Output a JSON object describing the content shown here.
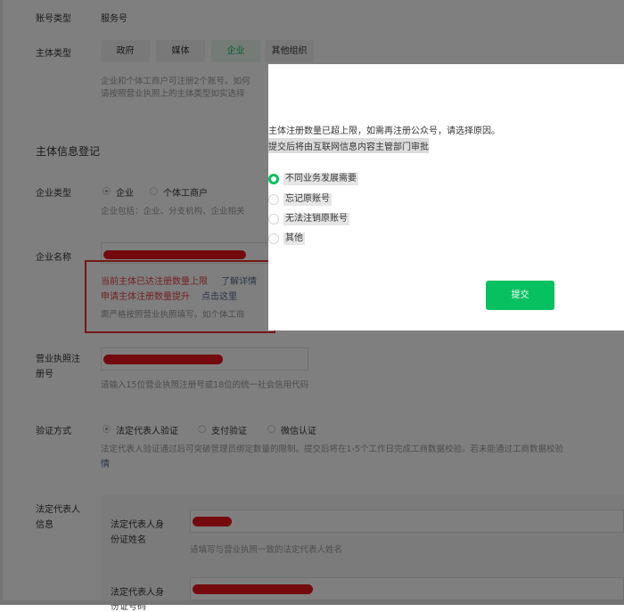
{
  "account_type": {
    "label": "账号类型",
    "value": "服务号"
  },
  "subject_type": {
    "label": "主体类型",
    "options": [
      "政府",
      "媒体",
      "企业",
      "其他组织"
    ],
    "selected": "企业",
    "hint_line1": "企业和个体工商户可注册2个账号。如何",
    "hint_line2": "请按照营业执照上的主体类型如实选择"
  },
  "section_title": "主体信息登记",
  "enterprise_type": {
    "label": "企业类型",
    "options": [
      "企业",
      "个体工商户"
    ],
    "selected": "企业",
    "hint": "企业包括：企业、分支机构、企业相关"
  },
  "enterprise_name": {
    "label": "企业名称",
    "error_line1": "当前主体已达注册数量上限",
    "error_link1": "了解详情",
    "error_line2": "申请主体注册数量提升",
    "error_link2": "点击这里",
    "hint": "需严格按照营业执照填写。如个体工商"
  },
  "license_number": {
    "label_line1": "营业执照注",
    "label_line2": "册号",
    "hint": "请输入15位营业执照注册号或18位的统一社会信用代码"
  },
  "verify_method": {
    "label": "验证方式",
    "options": [
      "法定代表人验证",
      "支付验证",
      "微信认证"
    ],
    "selected": "法定代表人验证",
    "hint_line1": "法定代表人验证通过后可突破管理员绑定数量的限制。提交后将在1-5个工作日完成工商数据校验。若未能通过工商数据校验",
    "hint_line2": "情"
  },
  "legal_rep": {
    "label_line1": "法定代表人",
    "label_line2": "信息",
    "name_label_line1": "法定代表人身",
    "name_label_line2": "份证姓名",
    "name_hint": "请填写与营业执照一致的法定代表人姓名",
    "id_label_line1": "法定代表人身",
    "id_label_line2": "份证号码"
  },
  "dialog": {
    "message_line1": "主体注册数量已超上限，如需再注册公众号，请选择原因。",
    "message_line2": "提交后将由互联网信息内容主管部门审批",
    "options": [
      "不同业务发展需要",
      "忘记原账号",
      "无法注销原账号",
      "其他"
    ],
    "selected_index": 0,
    "submit_label": "提交",
    "accent_color": "#07c160"
  },
  "colors": {
    "accent": "#07c160",
    "error": "#e64340",
    "link": "#576b95",
    "redaction": "#e8141b"
  }
}
